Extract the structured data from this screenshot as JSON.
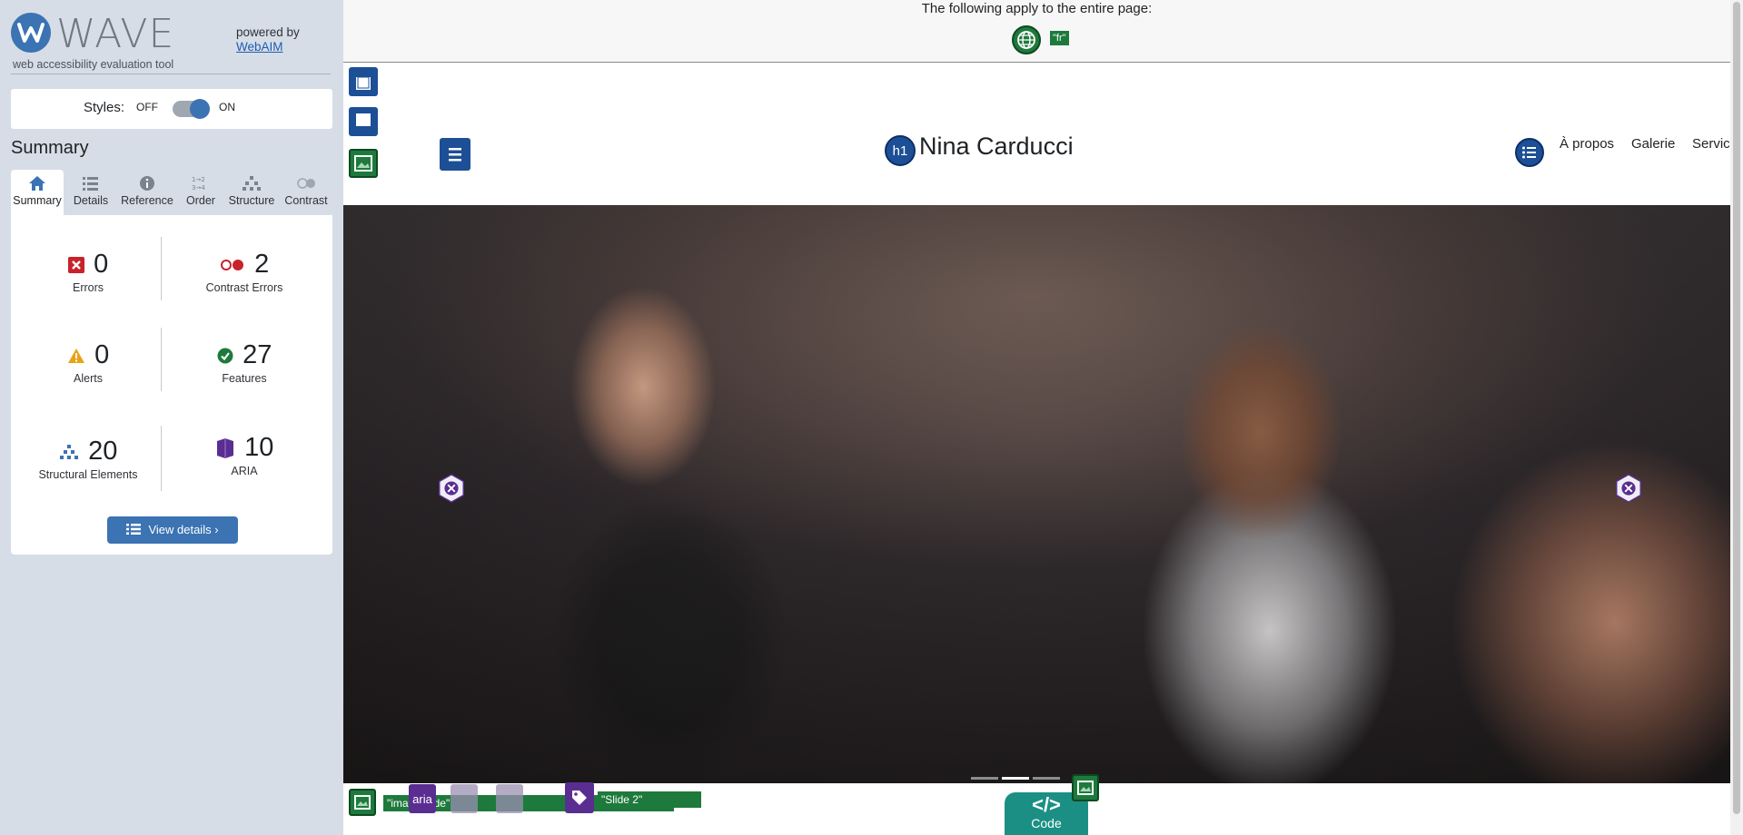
{
  "wave": {
    "brand_name": "WAVE",
    "tagline": "web accessibility evaluation tool",
    "powered_by": "powered by",
    "webaim_link": "WebAIM",
    "styles_label": "Styles:",
    "styles_off": "OFF",
    "styles_on": "ON",
    "styles_enabled": true,
    "summary_title": "Summary",
    "tabs": [
      {
        "label": "Summary",
        "icon": "home-icon",
        "active": true
      },
      {
        "label": "Details",
        "icon": "list-icon",
        "active": false
      },
      {
        "label": "Reference",
        "icon": "info-icon",
        "active": false
      },
      {
        "label": "Order",
        "icon": "order-icon",
        "active": false
      },
      {
        "label": "Structure",
        "icon": "structure-icon",
        "active": false
      },
      {
        "label": "Contrast",
        "icon": "contrast-icon",
        "active": false
      }
    ],
    "stats": {
      "errors": {
        "value": "0",
        "label": "Errors",
        "color": "#c8232c"
      },
      "contrast_errors": {
        "value": "2",
        "label": "Contrast Errors",
        "color": "#c8232c"
      },
      "alerts": {
        "value": "0",
        "label": "Alerts",
        "color": "#e8a317"
      },
      "features": {
        "value": "27",
        "label": "Features",
        "color": "#1e7a3c"
      },
      "structural": {
        "value": "20",
        "label": "Structural Elements",
        "color": "#3b73b3"
      },
      "aria": {
        "value": "10",
        "label": "ARIA",
        "color": "#5a2d91"
      }
    },
    "view_details": "View details ›"
  },
  "page": {
    "banner_text": "The following apply to the entire page:",
    "lang_badge": "\"fr\"",
    "site_title": "Nina Carducci",
    "h1_badge": "h1",
    "nav": [
      "À propos",
      "Galerie",
      "Servic"
    ],
    "aria_badge": "aria",
    "alt_label": "\"image slide\"",
    "slide_label": "\"Slide 2\"",
    "code_button": "Code",
    "code_glyph": "</>"
  },
  "colors": {
    "wave_blue": "#3b73b3",
    "sidebar_bg": "#d6dde6",
    "feature_green": "#1e7a3c",
    "aria_purple": "#5a2d91",
    "structure_blue": "#1d4f96",
    "code_teal": "#1b8f84"
  }
}
